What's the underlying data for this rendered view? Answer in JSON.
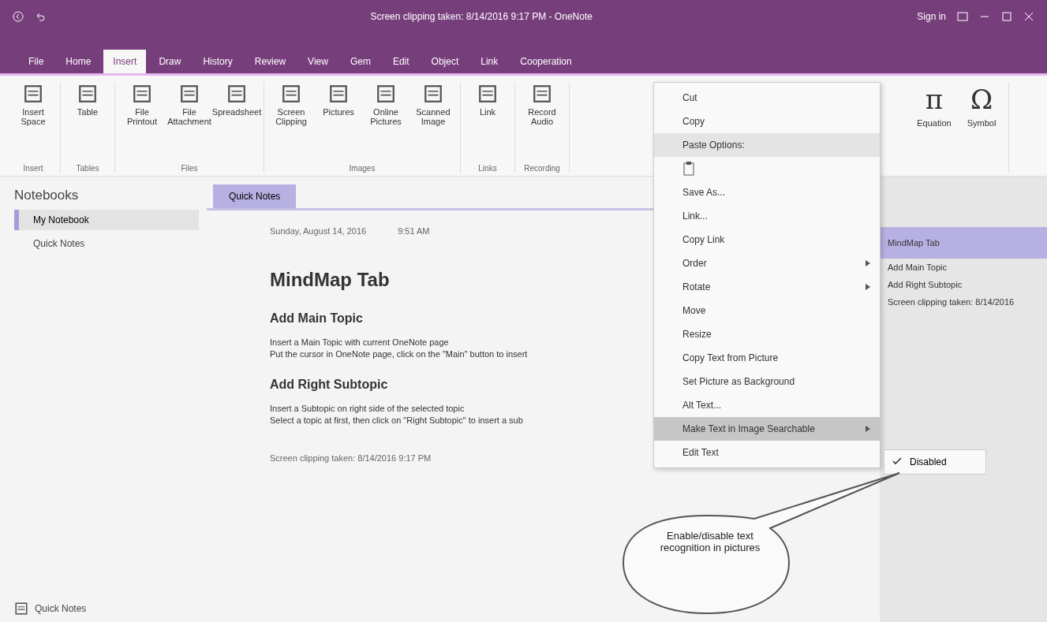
{
  "title_bar": {
    "title": "Screen clipping taken: 8/14/2016 9:17 PM - OneNote",
    "sign_in": "Sign in"
  },
  "ribbon_tabs": [
    {
      "label": "File",
      "selected": false
    },
    {
      "label": "Home",
      "selected": false
    },
    {
      "label": "Insert",
      "selected": true
    },
    {
      "label": "Draw",
      "selected": false
    },
    {
      "label": "History",
      "selected": false
    },
    {
      "label": "Review",
      "selected": false
    },
    {
      "label": "View",
      "selected": false
    },
    {
      "label": "Gem",
      "selected": false
    },
    {
      "label": "Edit",
      "selected": false
    },
    {
      "label": "Object",
      "selected": false
    },
    {
      "label": "Link",
      "selected": false
    },
    {
      "label": "Cooperation",
      "selected": false
    }
  ],
  "ribbon_groups": [
    {
      "label": "Insert",
      "buttons": [
        "Insert Space"
      ]
    },
    {
      "label": "Tables",
      "buttons": [
        "Table"
      ]
    },
    {
      "label": "Files",
      "buttons": [
        "File Printout",
        "File Attachment",
        "Spreadsheet"
      ]
    },
    {
      "label": "Images",
      "buttons": [
        "Screen Clipping",
        "Pictures",
        "Online Pictures",
        "Scanned Image"
      ]
    },
    {
      "label": "Links",
      "buttons": [
        "Link"
      ]
    },
    {
      "label": "Recording",
      "buttons": [
        "Record Audio"
      ]
    }
  ],
  "symbols_group": [
    {
      "glyph": "π",
      "label": "Equation"
    },
    {
      "glyph": "Ω",
      "label": "Symbol"
    }
  ],
  "notebooks": {
    "header": "Notebooks",
    "items": [
      {
        "label": "My Notebook",
        "selected": true
      }
    ],
    "sub_item": "Quick Notes",
    "footer": "Quick Notes"
  },
  "section_tabs": [
    {
      "label": "Quick Notes",
      "selected": true
    }
  ],
  "page": {
    "date": "Sunday, August 14, 2016",
    "time": "9:51 AM",
    "title": "MindMap Tab",
    "blocks": [
      {
        "kind": "heading",
        "text": "Add Main Topic"
      },
      {
        "kind": "paragraph",
        "lines": [
          "Insert a Main Topic with current OneNote page",
          "Put the cursor in OneNote page, click on the \"Main\" button to insert"
        ]
      },
      {
        "kind": "heading",
        "text": "Add Right Subtopic"
      },
      {
        "kind": "paragraph",
        "lines": [
          "Insert a Subtopic on right side of the selected topic",
          "Select a topic at first, then click on \"Right Subtopic\" to insert a sub"
        ]
      }
    ],
    "source": "Screen clipping taken: 8/14/2016 9:17 PM"
  },
  "context_menu": [
    {
      "kind": "item",
      "label": "Cut",
      "hovered": false,
      "selected": false,
      "submenu": false
    },
    {
      "kind": "item",
      "label": "Copy",
      "hovered": false,
      "selected": false,
      "submenu": false
    },
    {
      "kind": "item",
      "label": "Paste Options:",
      "hovered": true,
      "selected": false,
      "submenu": false
    },
    {
      "kind": "paste",
      "hovered": false,
      "selected": false,
      "submenu": false
    },
    {
      "kind": "item",
      "label": "Save As...",
      "hovered": false,
      "selected": false,
      "submenu": false
    },
    {
      "kind": "item",
      "label": "Link...",
      "hovered": false,
      "selected": false,
      "submenu": false
    },
    {
      "kind": "item",
      "label": "Copy Link",
      "hovered": false,
      "selected": false,
      "submenu": false
    },
    {
      "kind": "item",
      "label": "Order",
      "hovered": false,
      "selected": false,
      "submenu": true
    },
    {
      "kind": "item",
      "label": "Rotate",
      "hovered": false,
      "selected": false,
      "submenu": true
    },
    {
      "kind": "item",
      "label": "Move",
      "hovered": false,
      "selected": false,
      "submenu": false
    },
    {
      "kind": "item",
      "label": "Resize",
      "hovered": false,
      "selected": false,
      "submenu": false
    },
    {
      "kind": "item",
      "label": "Copy Text from Picture",
      "hovered": false,
      "selected": false,
      "submenu": false
    },
    {
      "kind": "item",
      "label": "Set Picture as Background",
      "hovered": false,
      "selected": false,
      "submenu": false
    },
    {
      "kind": "item",
      "label": "Alt Text...",
      "hovered": false,
      "selected": false,
      "submenu": false
    },
    {
      "kind": "item",
      "label": "Make Text in Image Searchable",
      "hovered": false,
      "selected": true,
      "submenu": true
    },
    {
      "kind": "item",
      "label": "Edit Text",
      "hovered": false,
      "selected": false,
      "submenu": false
    }
  ],
  "submenu": [
    {
      "label": "Disabled",
      "checked": true
    }
  ],
  "page_list": [
    {
      "label": "MindMap Tab",
      "selected": true
    },
    {
      "label": "Add Main Topic",
      "selected": false
    },
    {
      "label": "Add Right Subtopic",
      "selected": false
    },
    {
      "label": "Screen clipping taken: 8/14/2016",
      "selected": false
    }
  ],
  "callout": {
    "text": "Enable/disable text recognition in pictures"
  }
}
